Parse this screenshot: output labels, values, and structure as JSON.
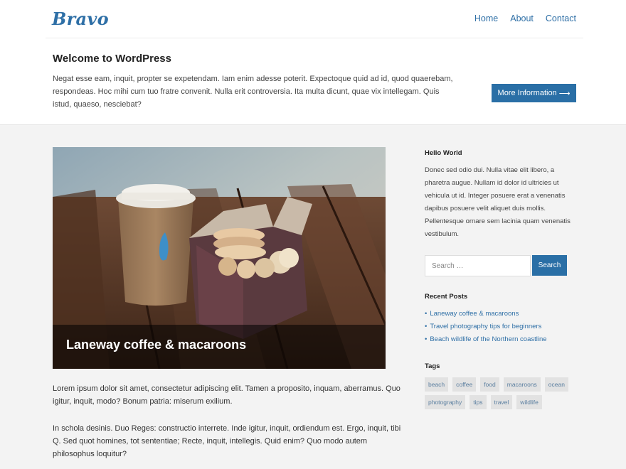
{
  "site": {
    "logo": "Bravo"
  },
  "nav": {
    "items": [
      "Home",
      "About",
      "Contact"
    ]
  },
  "welcome": {
    "title": "Welcome to WordPress",
    "text": "Negat esse eam, inquit, propter se expetendam. Iam enim adesse poterit. Expectoque quid ad id, quod quaerebam, respondeas. Hoc mihi cum tuo fratre convenit. Nulla erit controversia. Ita multa dicunt, quae vix intellegam. Quis istud, quaeso, nesciebat?",
    "button_label": "More Information",
    "button_arrow": "⟶"
  },
  "featured_post": {
    "title": "Laneway coffee & macaroons",
    "paragraphs": [
      "Lorem ipsum dolor sit amet, consectetur adipiscing elit. Tamen a proposito, inquam, aberramus. Quo igitur, inquit, modo? Bonum patria: miserum exilium.",
      "In schola desinis. Duo Reges: constructio interrete. Inde igitur, inquit, ordiendum est. Ergo, inquit, tibi Q. Sed quot homines, tot sententiae; Recte, inquit, intellegis. Quid enim? Quo modo autem philosophus loquitur?"
    ]
  },
  "sidebar": {
    "hello": {
      "title": "Hello World",
      "text": "Donec sed odio dui. Nulla vitae elit libero, a pharetra augue. Nullam id dolor id ultricies ut vehicula ut id. Integer posuere erat a venenatis dapibus posuere velit aliquet duis mollis. Pellentesque ornare sem lacinia quam venenatis vestibulum."
    },
    "search": {
      "placeholder": "Search …",
      "button": "Search"
    },
    "recent_posts": {
      "title": "Recent Posts",
      "items": [
        "Laneway coffee & macaroons",
        "Travel photography tips for beginners",
        "Beach wildlife of the Northern coastline"
      ]
    },
    "tags": {
      "title": "Tags",
      "items": [
        "beach",
        "coffee",
        "food",
        "macaroons",
        "ocean",
        "photography",
        "tips",
        "travel",
        "wildlife"
      ]
    }
  },
  "colors": {
    "accent": "#2a6fa6",
    "link": "#2e6fa6",
    "background": "#f3f3f3"
  }
}
